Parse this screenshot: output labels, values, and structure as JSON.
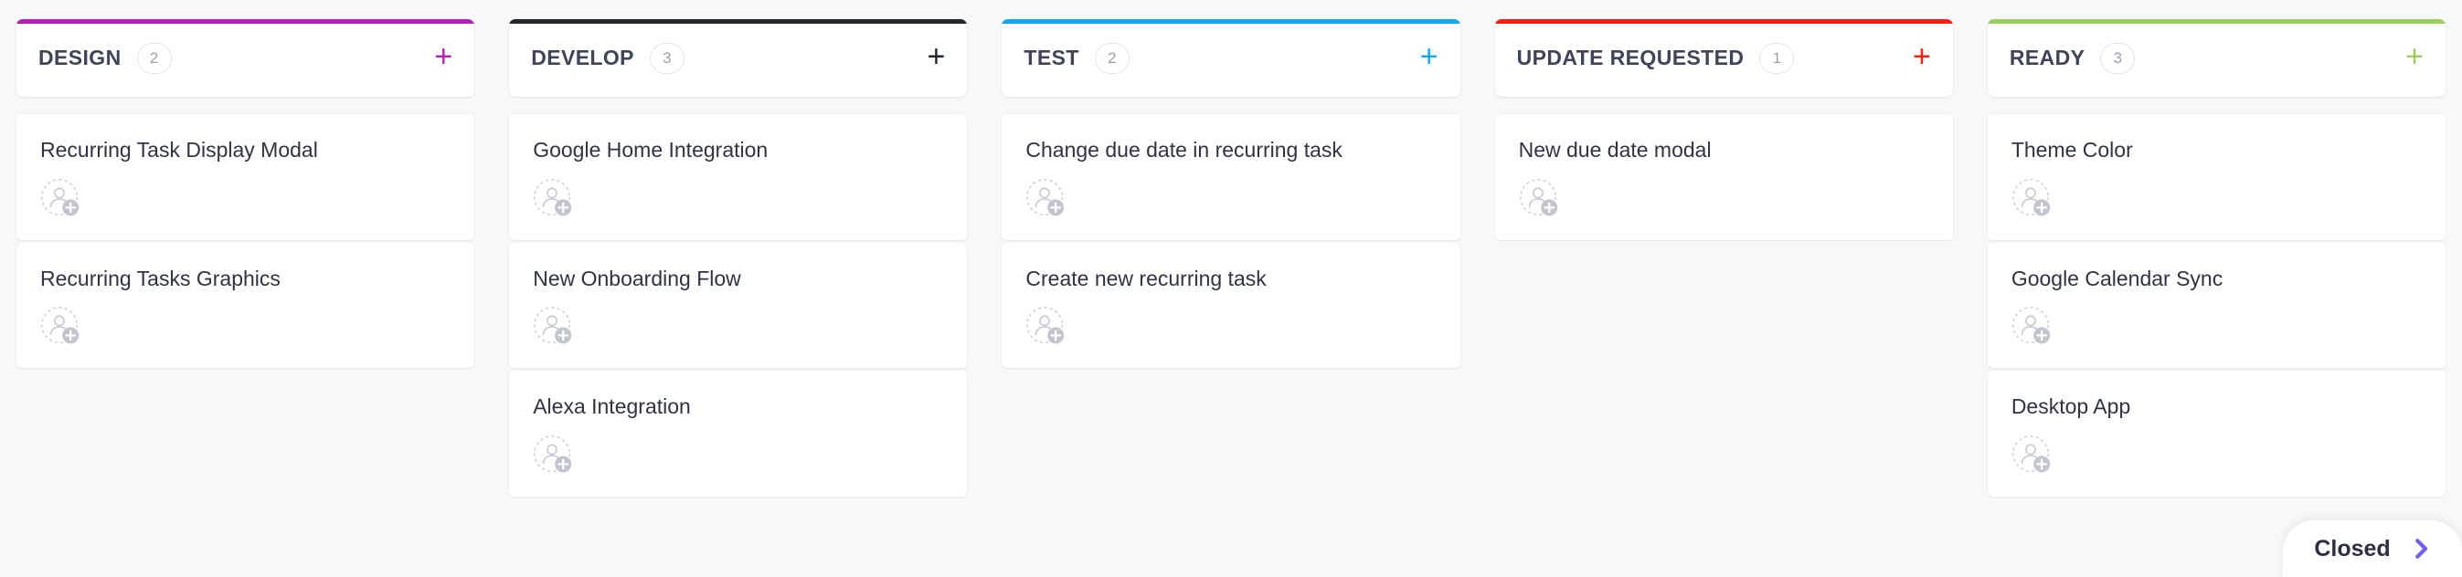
{
  "board": {
    "background_color": "#f7f8fa",
    "columns": [
      {
        "name": "DESIGN",
        "count": "2",
        "accent_color": "#b41fb4",
        "add_icon": "plus-icon",
        "add_label": "+",
        "cards": [
          {
            "title": "Recurring Task Display Modal",
            "assignee_icon": "add-assignee-icon"
          },
          {
            "title": "Recurring Tasks Graphics",
            "assignee_icon": "add-assignee-icon"
          }
        ]
      },
      {
        "name": "DEVELOP",
        "count": "3",
        "accent_color": "#23282c",
        "add_icon": "plus-icon",
        "add_label": "+",
        "cards": [
          {
            "title": "Google Home Integration",
            "assignee_icon": "add-assignee-icon"
          },
          {
            "title": "New Onboarding Flow",
            "assignee_icon": "add-assignee-icon"
          },
          {
            "title": "Alexa Integration",
            "assignee_icon": "add-assignee-icon"
          }
        ]
      },
      {
        "name": "TEST",
        "count": "2",
        "accent_color": "#11a7f4",
        "add_icon": "plus-icon",
        "add_label": "+",
        "cards": [
          {
            "title": "Change due date in recurring task",
            "assignee_icon": "add-assignee-icon"
          },
          {
            "title": "Create new recurring task",
            "assignee_icon": "add-assignee-icon"
          }
        ]
      },
      {
        "name": "UPDATE REQUESTED",
        "count": "1",
        "accent_color": "#fa1e0e",
        "add_icon": "plus-icon",
        "add_label": "+",
        "cards": [
          {
            "title": "New due date modal",
            "assignee_icon": "add-assignee-icon"
          }
        ]
      },
      {
        "name": "READY",
        "count": "3",
        "accent_color": "#9dcd5a",
        "add_icon": "plus-icon",
        "add_label": "+",
        "cards": [
          {
            "title": "Theme Color",
            "assignee_icon": "add-assignee-icon"
          },
          {
            "title": "Google Calendar Sync",
            "assignee_icon": "add-assignee-icon"
          },
          {
            "title": "Desktop App",
            "assignee_icon": "add-assignee-icon"
          }
        ]
      }
    ]
  },
  "closed_panel": {
    "label": "Closed",
    "chevron_icon": "chevron-right-icon",
    "chevron_color": "#7260e8"
  }
}
